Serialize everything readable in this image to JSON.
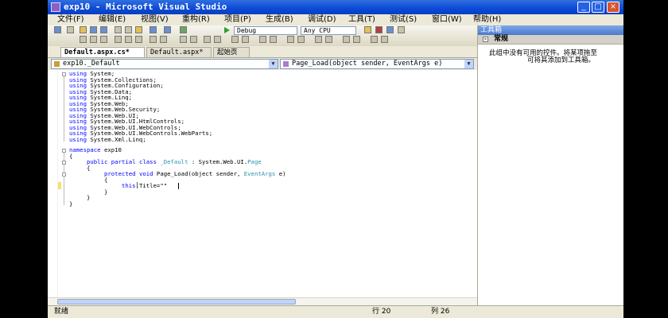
{
  "window": {
    "title": "exp10 - Microsoft Visual Studio"
  },
  "menu": [
    "文件(F)",
    "编辑(E)",
    "视图(V)",
    "重构(R)",
    "项目(P)",
    "生成(B)",
    "调试(D)",
    "工具(T)",
    "测试(S)",
    "窗口(W)",
    "帮助(H)"
  ],
  "toolbar": {
    "config": "Debug",
    "platform": "Any CPU"
  },
  "tabs": [
    "Default.aspx.cs*",
    "Default.aspx*",
    "起始页"
  ],
  "nav": {
    "class_selector": "exp10._Default",
    "member_selector": "Page_Load(object sender, EventArgs e)"
  },
  "code": {
    "usings": [
      [
        "using",
        " System;"
      ],
      [
        "using",
        " System.Collections;"
      ],
      [
        "using",
        " System.Configuration;"
      ],
      [
        "using",
        " System.Data;"
      ],
      [
        "using",
        " System.Linq;"
      ],
      [
        "using",
        " System.Web;"
      ],
      [
        "using",
        " System.Web.Security;"
      ],
      [
        "using",
        " System.Web.UI;"
      ],
      [
        "using",
        " System.Web.UI.HtmlControls;"
      ],
      [
        "using",
        " System.Web.UI.WebControls;"
      ],
      [
        "using",
        " System.Web.UI.WebControls.WebParts;"
      ],
      [
        "using",
        " System.Xml.Linq;"
      ]
    ],
    "ns_kw": "namespace",
    "ns_name": " exp10",
    "open1": "{",
    "cls_kw1": "public",
    "cls_kw2": "partial",
    "cls_kw3": "class",
    "cls_name": "_Default",
    "cls_colon": " : System.Web.UI.",
    "cls_base": "Page",
    "open2": "{",
    "m_kw1": "protected",
    "m_kw2": "void",
    "m_sig1": " Page_Load(object sender, ",
    "m_type": "EventArgs",
    "m_sig2": " e)",
    "open3": "{",
    "stmt_kw": "this",
    "stmt_rest": ".Title=\"\"",
    "close3": "}",
    "close2": "}",
    "close1": "}"
  },
  "status": {
    "left": "就绪",
    "line_label": "行 20",
    "col_label": "列 26"
  },
  "toolbox": {
    "title": "工具箱",
    "group": "常规",
    "message_line1": "此组中没有可用的控件。将某项拖至",
    "message_line2": "可将其添加到工具箱。"
  }
}
